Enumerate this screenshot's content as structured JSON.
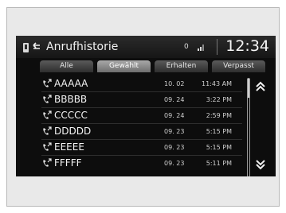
{
  "header": {
    "title": "Anrufhistorie",
    "status_text": "0",
    "clock": "12:34"
  },
  "tabs": [
    {
      "label": "Alle",
      "active": false
    },
    {
      "label": "Gewählt",
      "active": true
    },
    {
      "label": "Erhalten",
      "active": false
    },
    {
      "label": "Verpasst",
      "active": false
    }
  ],
  "calls": [
    {
      "name": "AAAAA",
      "date": "10. 02",
      "time": "11:43 AM"
    },
    {
      "name": "BBBBB",
      "date": "09. 24",
      "time": "3:22 PM"
    },
    {
      "name": "CCCCC",
      "date": "09. 24",
      "time": "2:59 PM"
    },
    {
      "name": "DDDDD",
      "date": "09. 23",
      "time": "5:15 PM"
    },
    {
      "name": "EEEEE",
      "date": "09. 23",
      "time": "5:15 PM"
    },
    {
      "name": "FFFFF",
      "date": "09. 23",
      "time": "5:11 PM"
    }
  ],
  "icons": {
    "phone": "phone-icon",
    "back": "back-icon",
    "signal": "signal-icon",
    "call": "outgoing-call-icon",
    "scroll_up": "double-chevron-up-icon",
    "scroll_down": "double-chevron-down-icon"
  },
  "colors": {
    "screen_bg": "#0d0d0d",
    "text": "#f4f4f4",
    "tab_active": "#8f8f8f",
    "tab_inactive": "#3d3d3d"
  }
}
